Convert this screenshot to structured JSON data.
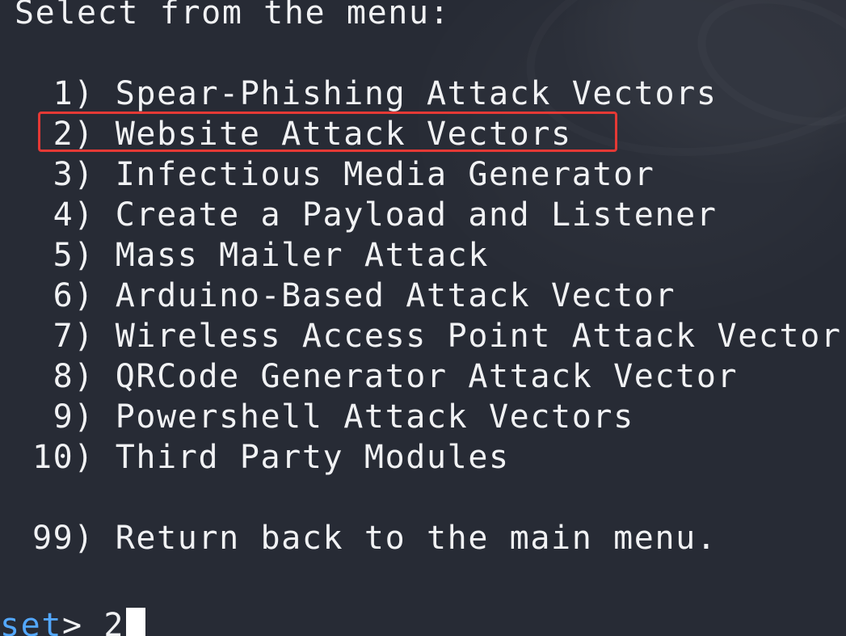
{
  "terminal": {
    "header": "Select from the menu:",
    "menu_items": [
      " 1) Spear-Phishing Attack Vectors",
      " 2) Website Attack Vectors",
      " 3) Infectious Media Generator",
      " 4) Create a Payload and Listener",
      " 5) Mass Mailer Attack",
      " 6) Arduino-Based Attack Vector",
      " 7) Wireless Access Point Attack Vector",
      " 8) QRCode Generator Attack Vector",
      " 9) Powershell Attack Vectors",
      "10) Third Party Modules"
    ],
    "return_item": "99) Return back to the main menu.",
    "prompt": {
      "prefix": "set",
      "symbol": "> ",
      "input": "2"
    }
  },
  "colors": {
    "background": "#272b35",
    "text": "#f1f2f4",
    "prompt": "#53a8ff",
    "highlight": "#e53935"
  }
}
